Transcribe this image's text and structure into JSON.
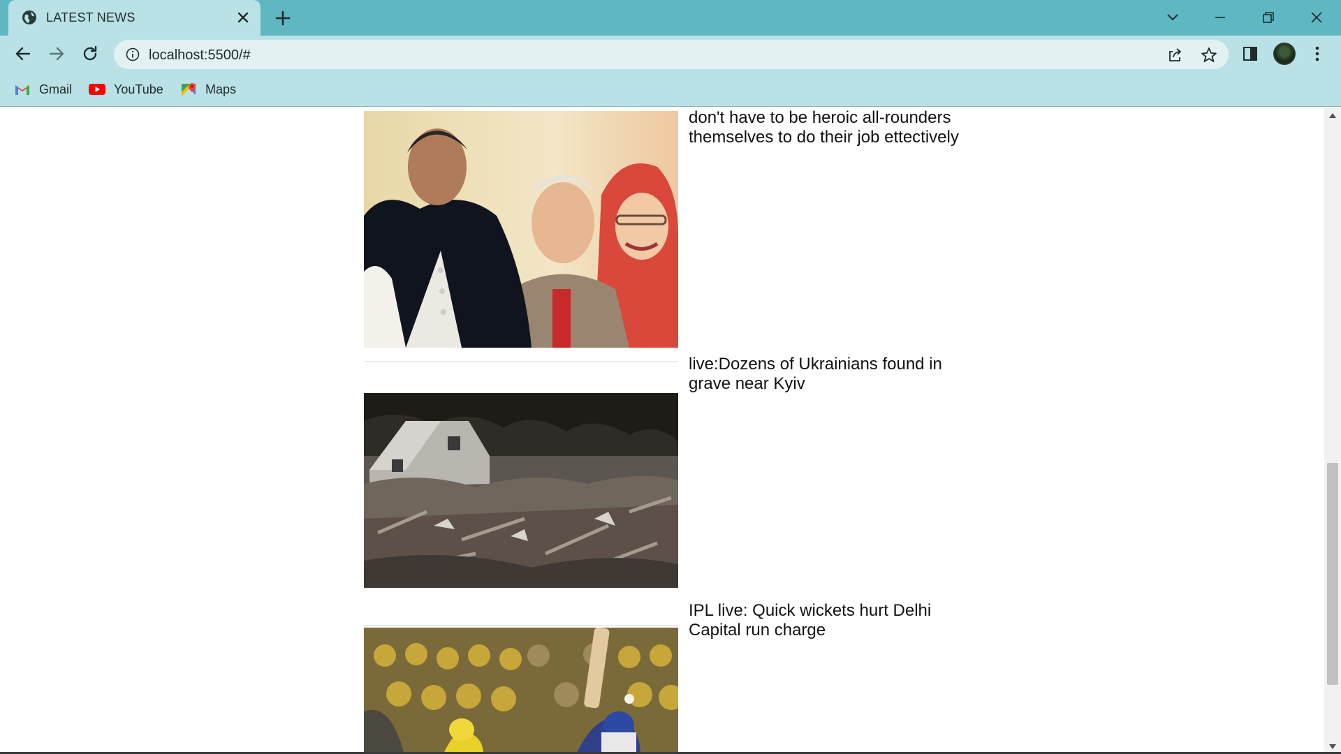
{
  "browser": {
    "tab_title": "LATEST NEWS",
    "url": "localhost:5500/#",
    "bookmarks": [
      {
        "label": "Gmail",
        "icon": "gmail-icon"
      },
      {
        "label": "YouTube",
        "icon": "youtube-icon"
      },
      {
        "label": "Maps",
        "icon": "maps-icon"
      }
    ],
    "colors": {
      "tabstrip": "#5fb7c1",
      "toolbar": "#b9e1e6",
      "omnibox": "#e3f1f3"
    }
  },
  "news": [
    {
      "headline": "don't have to be heroic all-rounders themselves to do their job ettectively",
      "image": "politicians-photo"
    },
    {
      "headline": "live:Dozens of Ukrainians found in grave near Kyiv",
      "image": "destroyed-house-photo"
    },
    {
      "headline": "IPL live: Quick wickets hurt Delhi Capital run charge",
      "image": "cricket-batsman-photo"
    }
  ],
  "scrollbar": {
    "position_fraction": 0.62
  }
}
